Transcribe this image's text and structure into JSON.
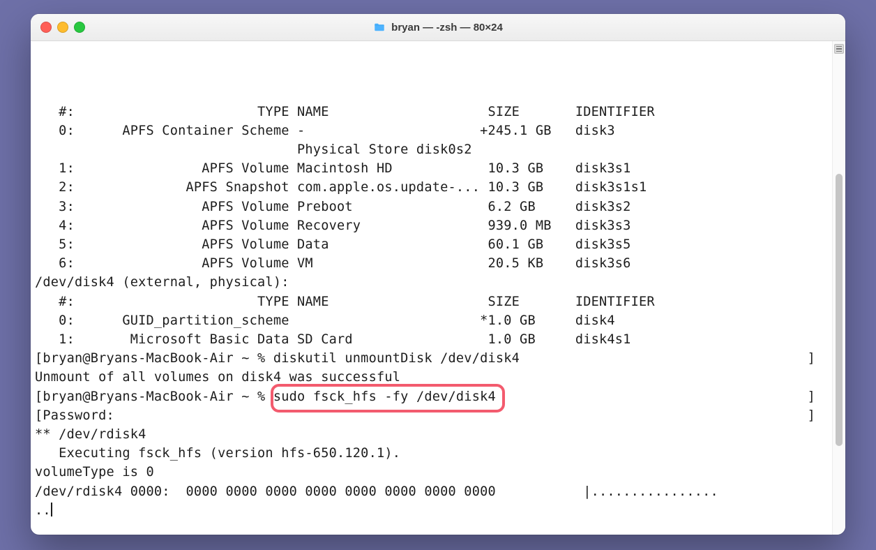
{
  "window": {
    "title": "bryan — -zsh — 80×24"
  },
  "header_line": "   #:                       TYPE NAME                    SIZE       IDENTIFIER",
  "rows": [
    "   0:      APFS Container Scheme -                      +245.1 GB   disk3",
    "                                 Physical Store disk0s2",
    "   1:                APFS Volume Macintosh HD            10.3 GB    disk3s1",
    "   2:              APFS Snapshot com.apple.os.update-... 10.3 GB    disk3s1s1",
    "   3:                APFS Volume Preboot                 6.2 GB     disk3s2",
    "   4:                APFS Volume Recovery                939.0 MB   disk3s3",
    "   5:                APFS Volume Data                    60.1 GB    disk3s5",
    "   6:                APFS Volume VM                      20.5 KB    disk3s6"
  ],
  "disk4_header": "/dev/disk4 (external, physical):",
  "disk4_cols": "   #:                       TYPE NAME                    SIZE       IDENTIFIER",
  "disk4_rows": [
    "   0:      GUID_partition_scheme                        *1.0 GB     disk4",
    "   1:       Microsoft Basic Data SD Card                 1.0 GB     disk4s1"
  ],
  "prompt1": "bryan@Bryans-MacBook-Air ~ % diskutil unmountDisk /dev/disk4",
  "unmount_result": "Unmount of all volumes on disk4 was successful",
  "prompt2": "bryan@Bryans-MacBook-Air ~ % sudo fsck_hfs -fy /dev/disk4",
  "password_line": "Password:",
  "fsck_lines": [
    "** /dev/rdisk4",
    "   Executing fsck_hfs (version hfs-650.120.1).",
    "volumeType is 0",
    "/dev/rdisk4 0000:  0000 0000 0000 0000 0000 0000 0000 0000           |................",
    ".."
  ],
  "highlight": {
    "text": "sudo fsck_hfs -fy /dev/disk4"
  }
}
